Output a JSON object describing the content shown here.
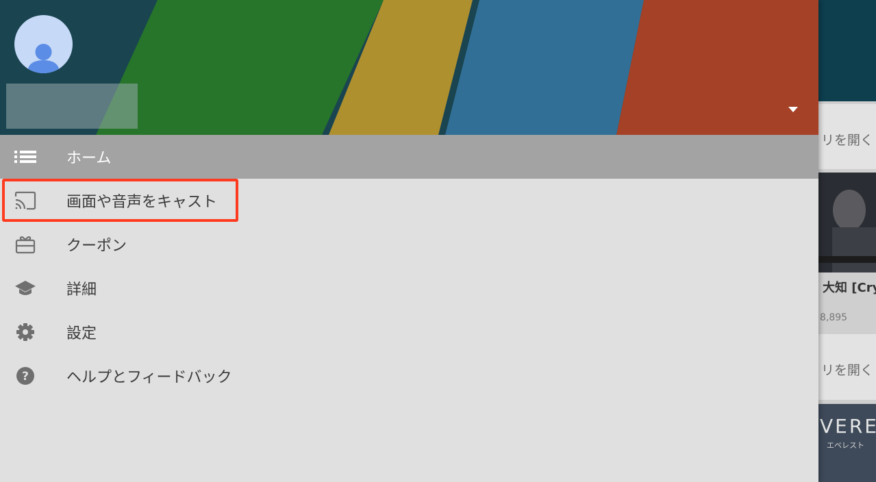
{
  "drawer": {
    "account": {
      "name": ""
    },
    "menu": [
      {
        "id": "home",
        "label": "ホーム",
        "icon": "list-icon",
        "active": true
      },
      {
        "id": "cast",
        "label": "画面や音声をキャスト",
        "icon": "cast-icon",
        "active": false
      },
      {
        "id": "coupon",
        "label": "クーポン",
        "icon": "coupon-icon",
        "active": false
      },
      {
        "id": "details",
        "label": "詳細",
        "icon": "graduation-cap-icon",
        "active": false
      },
      {
        "id": "settings",
        "label": "設定",
        "icon": "gear-icon",
        "active": false
      },
      {
        "id": "help",
        "label": "ヘルプとフィードバック",
        "icon": "help-icon",
        "active": false
      }
    ]
  },
  "background": {
    "card1_text": "リを開く",
    "video_title": "大知 [Cry",
    "video_views": "8,895",
    "card2_text": "リを開く",
    "thumb_caption": "VERES",
    "thumb_subcaption": "エベレスト"
  },
  "colors": {
    "highlight": "#ff3b1f",
    "active_row": "#a3a3a3",
    "drawer_bg": "#e0e0e0"
  }
}
